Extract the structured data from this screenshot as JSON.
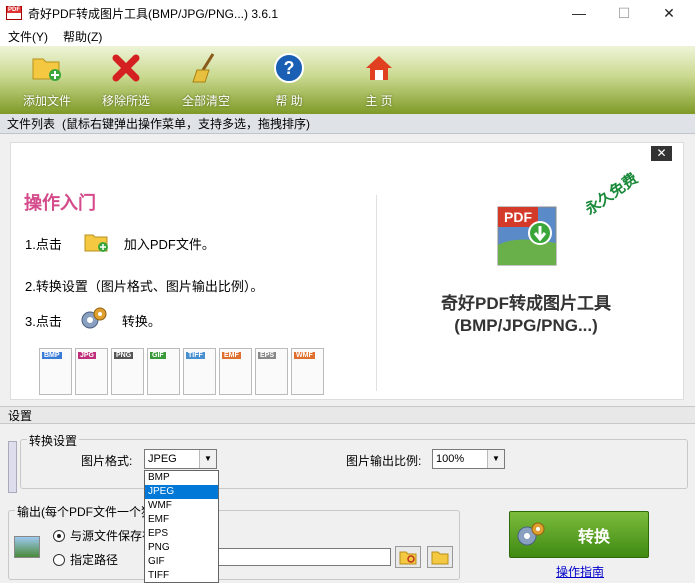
{
  "window": {
    "title": "奇好PDF转成图片工具(BMP/JPG/PNG...) 3.6.1",
    "minimize": "—",
    "maximize": "☐",
    "close": "✕"
  },
  "menu": [
    "文件(Y)",
    "帮助(Z)"
  ],
  "toolbar": {
    "add_file": "添加文件",
    "remove_selected": "移除所选",
    "clear_all": "全部清空",
    "help": "帮 助",
    "home": "主 页"
  },
  "filelist": {
    "label": "文件列表",
    "hint": "(鼠标右键弹出操作菜单，支持多选，拖拽排序)"
  },
  "intro": {
    "close": "✕",
    "title": "操作入门",
    "step1_prefix": "1.点击",
    "step1_text": "加入PDF文件。",
    "step2": "2.转换设置（图片格式、图片输出比例）。",
    "step3_prefix": "3.点击",
    "step3_text": "转换。",
    "free_badge": "永久免费",
    "product_line1": "奇好PDF转成图片工具",
    "product_line2": "(BMP/JPG/PNG...)",
    "pdf_logo_text": "PDF",
    "formats": [
      {
        "tag": "BMP",
        "color": "#3a7bd5"
      },
      {
        "tag": "JPG",
        "color": "#c0307a"
      },
      {
        "tag": "PNG",
        "color": "#555555"
      },
      {
        "tag": "GIF",
        "color": "#3a9a3a"
      },
      {
        "tag": "TIFF",
        "color": "#4a90d0"
      },
      {
        "tag": "EMF",
        "color": "#e07030"
      },
      {
        "tag": "EPS",
        "color": "#888888"
      },
      {
        "tag": "WMF",
        "color": "#e07030"
      }
    ]
  },
  "settings": {
    "header": "设置",
    "convert_group": "转换设置",
    "format_label": "图片格式:",
    "format_value": "JPEG",
    "scale_label": "图片输出比例:",
    "scale_value": "100%",
    "dropdown_options": [
      "BMP",
      "JPEG",
      "WMF",
      "EMF",
      "EPS",
      "PNG",
      "GIF",
      "TIFF"
    ],
    "dropdown_selected": "JPEG",
    "output_group": "输出(每个PDF文件一个独",
    "radio_source": "与源文件保存在",
    "radio_custom": "指定路径",
    "convert_button": "转换",
    "guide_link": "操作指南"
  }
}
